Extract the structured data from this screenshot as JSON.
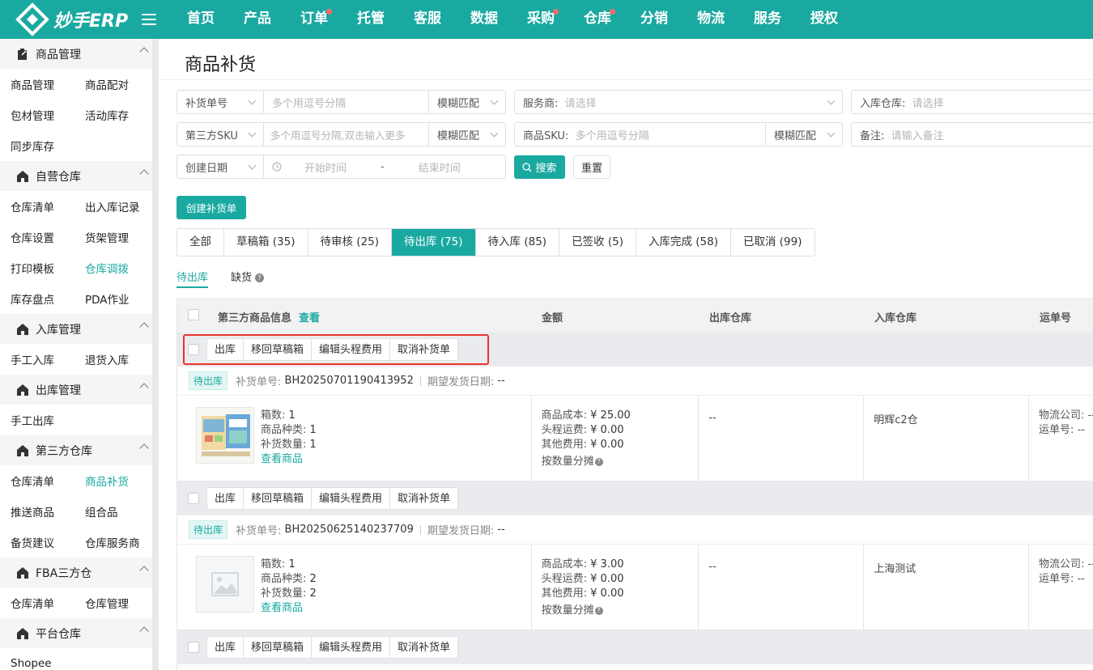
{
  "app": {
    "logo_text": "妙手ERP"
  },
  "nav": [
    {
      "label": "首页",
      "dot": false
    },
    {
      "label": "产品",
      "dot": false
    },
    {
      "label": "订单",
      "dot": true
    },
    {
      "label": "托管",
      "dot": false
    },
    {
      "label": "客服",
      "dot": false
    },
    {
      "label": "数据",
      "dot": false
    },
    {
      "label": "采购",
      "dot": true
    },
    {
      "label": "仓库",
      "dot": true
    },
    {
      "label": "分销",
      "dot": false
    },
    {
      "label": "物流",
      "dot": false
    },
    {
      "label": "服务",
      "dot": false
    },
    {
      "label": "授权",
      "dot": false
    }
  ],
  "sidebar": {
    "groups": [
      {
        "title": "商品管理",
        "icon": "clipboard-icon",
        "rows": [
          [
            "商品管理",
            "商品配对"
          ],
          [
            "包材管理",
            "活动库存"
          ],
          [
            "同步库存"
          ]
        ]
      },
      {
        "title": "自营仓库",
        "icon": "house-icon",
        "rows": [
          [
            "仓库清单",
            "出入库记录"
          ],
          [
            "仓库设置",
            "货架管理"
          ],
          [
            "打印模板",
            "仓库调拨"
          ],
          [
            "库存盘点",
            "PDA作业"
          ]
        ]
      },
      {
        "title": "入库管理",
        "icon": "house-icon",
        "rows": [
          [
            "手工入库",
            "退货入库"
          ]
        ]
      },
      {
        "title": "出库管理",
        "icon": "house-icon",
        "rows": [
          [
            "手工出库"
          ]
        ]
      },
      {
        "title": "第三方仓库",
        "icon": "house-icon",
        "rows": [
          [
            "仓库清单",
            "商品补货"
          ],
          [
            "推送商品",
            "组合品"
          ],
          [
            "备货建议",
            "仓库服务商"
          ]
        ]
      },
      {
        "title": "FBA三方仓",
        "icon": "house-icon",
        "rows": [
          [
            "仓库清单",
            "仓库管理"
          ]
        ]
      },
      {
        "title": "平台仓库",
        "icon": "house-icon",
        "rows": [
          [
            "Shopee"
          ]
        ]
      }
    ],
    "active_items": [
      "仓库调拨",
      "商品补货"
    ]
  },
  "page": {
    "title": "商品补货"
  },
  "filters": {
    "row1": {
      "order_no_select": "补货单号",
      "order_no_placeholder": "多个用逗号分隔",
      "order_no_match": "模糊匹配",
      "provider_label": "服务商:",
      "provider_placeholder": "请选择",
      "warehouse_label": "入库仓库:",
      "warehouse_placeholder": "请选择"
    },
    "row2": {
      "sku_select": "第三方SKU",
      "sku_placeholder": "多个用逗号分隔,双击输入更多",
      "sku_match": "模糊匹配",
      "product_sku_label": "商品SKU:",
      "product_sku_placeholder": "多个用逗号分隔",
      "product_sku_match": "模糊匹配",
      "remark_label": "备注:",
      "remark_placeholder": "请输入备注"
    },
    "row3": {
      "date_select": "创建日期",
      "start_placeholder": "开始时间",
      "dash": "-",
      "end_placeholder": "结束时间"
    },
    "search_label": "搜索",
    "reset_label": "重置"
  },
  "create_button": "创建补货单",
  "tabs": [
    {
      "label": "全部",
      "active": false
    },
    {
      "label": "草稿箱 (35)",
      "active": false
    },
    {
      "label": "待审核 (25)",
      "active": false
    },
    {
      "label": "待出库 (75)",
      "active": true
    },
    {
      "label": "待入库 (85)",
      "active": false
    },
    {
      "label": "已签收 (5)",
      "active": false
    },
    {
      "label": "入库完成 (58)",
      "active": false
    },
    {
      "label": "已取消 (99)",
      "active": false
    }
  ],
  "subtabs": {
    "pending": "待出库",
    "shortage": "缺货",
    "help": "?"
  },
  "table": {
    "headers": {
      "product": "第三方商品信息",
      "view": "查看",
      "amount": "金额",
      "out_wh": "出库仓库",
      "in_wh": "入库仓库",
      "tracking": "运单号"
    },
    "actions": [
      "出库",
      "移回草稿箱",
      "编辑头程费用",
      "取消补货单"
    ],
    "orders": [
      {
        "status": "待出库",
        "order_no_label": "补货单号:",
        "order_no": "BH20250701190413952",
        "expected_label": "期望发货日期:",
        "expected": "--",
        "boxes_label": "箱数:",
        "boxes": "1",
        "kinds_label": "商品种类:",
        "kinds": "1",
        "qty_label": "补货数量:",
        "qty": "1",
        "view_goods": "查看商品",
        "cost_label": "商品成本:",
        "cost": "¥ 25.00",
        "freight_label": "头程运费:",
        "freight": "¥ 0.00",
        "other_label": "其他费用:",
        "other": "¥ 0.00",
        "alloc": "按数量分摊",
        "out_wh": "--",
        "in_wh": "明辉c2仓",
        "carrier_label": "物流公司:",
        "carrier": "--",
        "tracking_label": "运单号:",
        "tracking": "--",
        "has_image": true
      },
      {
        "status": "待出库",
        "order_no_label": "补货单号:",
        "order_no": "BH20250625140237709",
        "expected_label": "期望发货日期:",
        "expected": "--",
        "boxes_label": "箱数:",
        "boxes": "1",
        "kinds_label": "商品种类:",
        "kinds": "2",
        "qty_label": "补货数量:",
        "qty": "2",
        "view_goods": "查看商品",
        "cost_label": "商品成本:",
        "cost": "¥ 3.00",
        "freight_label": "头程运费:",
        "freight": "¥ 0.00",
        "other_label": "其他费用:",
        "other": "¥ 0.00",
        "alloc": "按数量分摊",
        "out_wh": "--",
        "in_wh": "上海测试",
        "carrier_label": "物流公司:",
        "carrier": "--",
        "tracking_label": "运单号:",
        "tracking": "--",
        "has_image": false
      }
    ]
  },
  "colors": {
    "brand": "#1aa9a1",
    "highlight": "#e8352e",
    "dot": "#ff6b6b"
  }
}
